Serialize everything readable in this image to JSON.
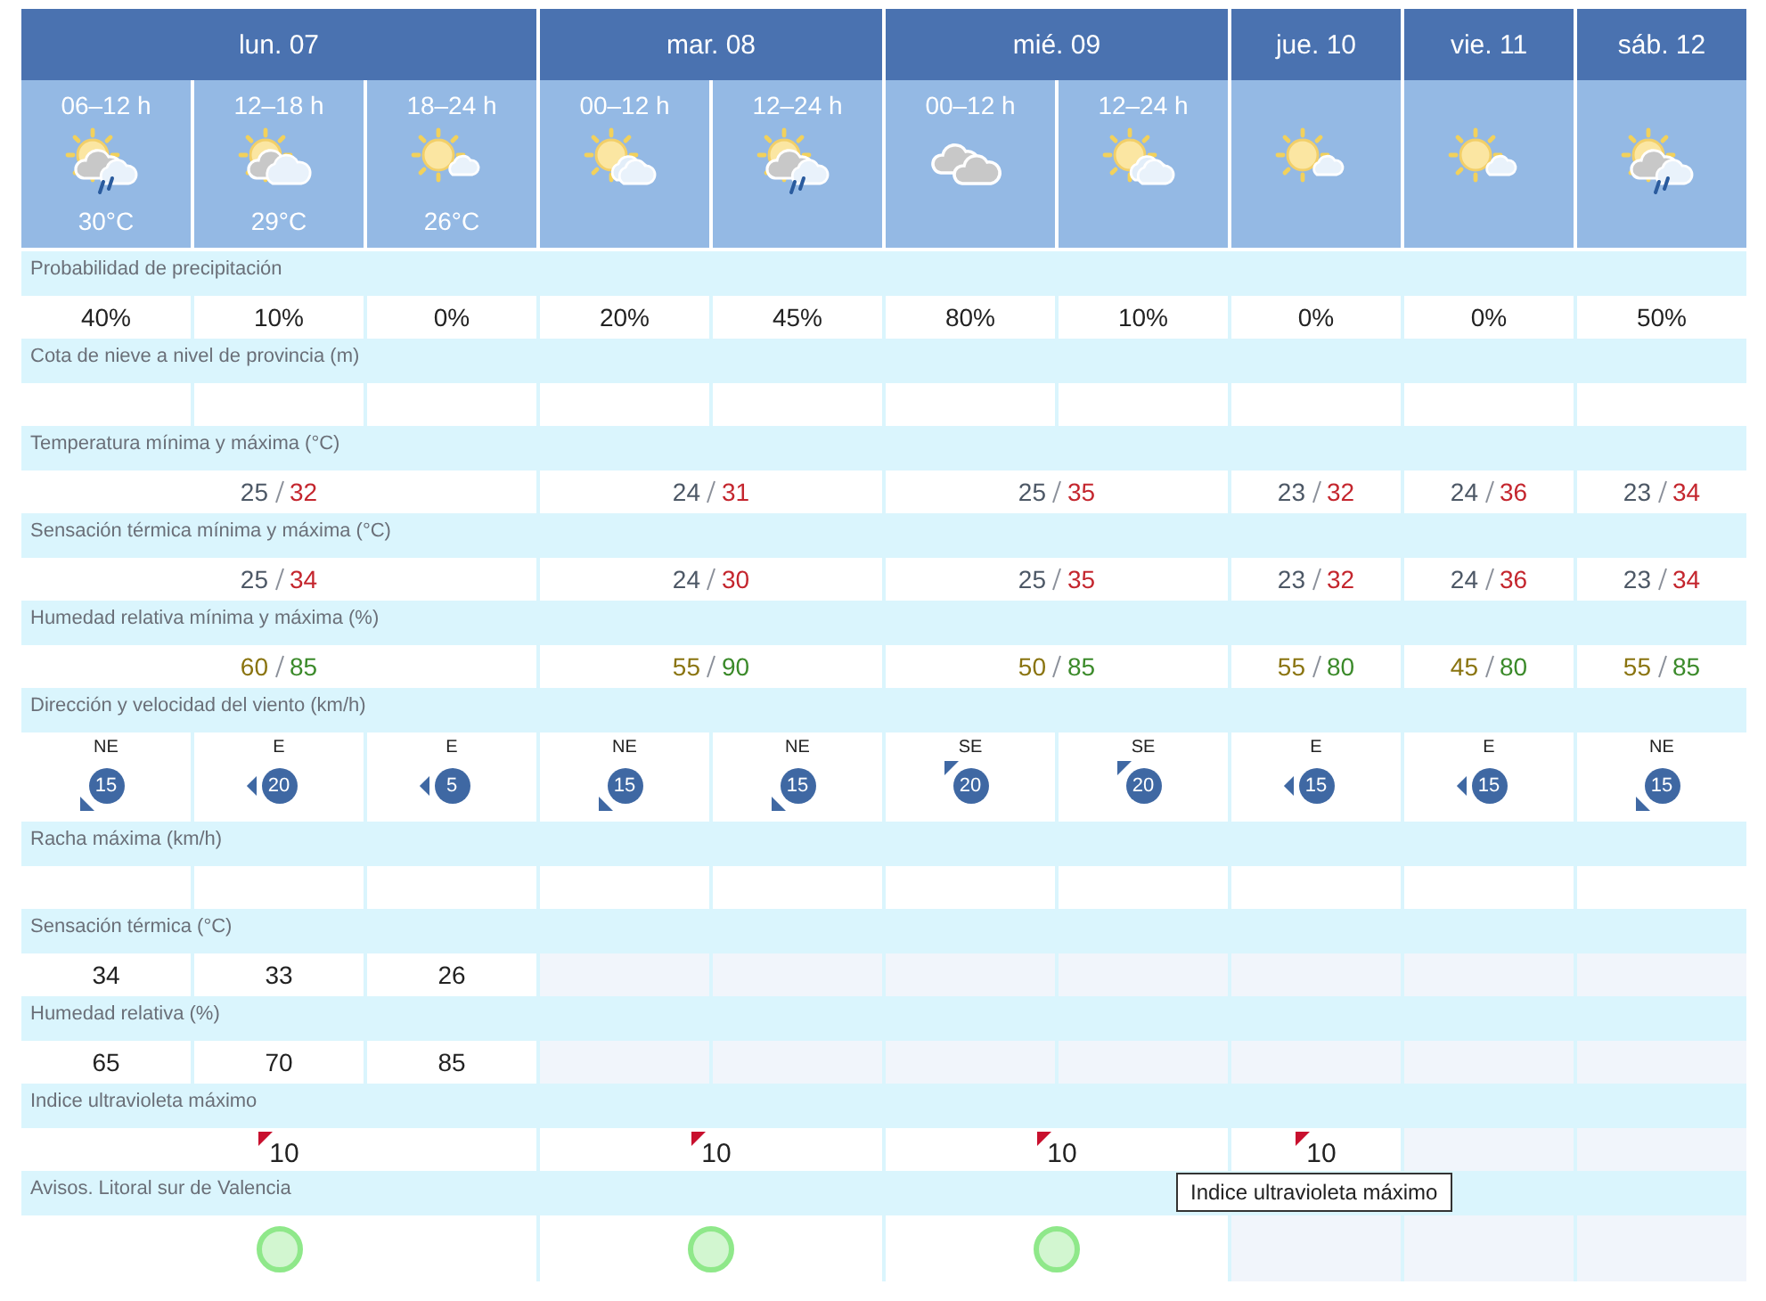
{
  "days": [
    {
      "label": "lun. 07",
      "periods": [
        {
          "label": "06–12 h",
          "kind": "sun-grey-cloud-rain",
          "temp": "30°C"
        },
        {
          "label": "12–18 h",
          "kind": "sun-grey-cloud",
          "temp": "29°C"
        },
        {
          "label": "18–24 h",
          "kind": "sun-small-cloud",
          "temp": "26°C"
        }
      ]
    },
    {
      "label": "mar. 08",
      "periods": [
        {
          "label": "00–12 h",
          "kind": "sun-clouds"
        },
        {
          "label": "12–24 h",
          "kind": "sun-grey-cloud-rain"
        }
      ]
    },
    {
      "label": "mié. 09",
      "periods": [
        {
          "label": "00–12 h",
          "kind": "grey-clouds"
        },
        {
          "label": "12–24 h",
          "kind": "sun-clouds"
        }
      ]
    },
    {
      "label": "jue. 10",
      "periods": [
        {
          "kind": "sun-small-cloud"
        }
      ]
    },
    {
      "label": "vie. 11",
      "periods": [
        {
          "kind": "sun-small-cloud"
        }
      ]
    },
    {
      "label": "sáb. 12",
      "periods": [
        {
          "kind": "sun-grey-cloud-rain"
        }
      ]
    }
  ],
  "rows": [
    {
      "title": "Probabilidad de precipitación",
      "kind": "period",
      "values": [
        {
          "kind": "value",
          "text": "40%"
        },
        {
          "kind": "value",
          "text": "10%"
        },
        {
          "kind": "value",
          "text": "0%"
        },
        {
          "kind": "value",
          "text": "20%"
        },
        {
          "kind": "value",
          "text": "45%"
        },
        {
          "kind": "value",
          "text": "80%"
        },
        {
          "kind": "value",
          "text": "10%"
        },
        {
          "kind": "value",
          "text": "0%"
        },
        {
          "kind": "value",
          "text": "0%"
        },
        {
          "kind": "value",
          "text": "50%"
        }
      ]
    },
    {
      "title": "Cota de nieve a nivel de provincia (m)",
      "kind": "blank"
    },
    {
      "title": "Temperatura mínima y máxima (°C)",
      "kind": "minmax-temperature",
      "values": [
        {
          "min": "25",
          "max": "32"
        },
        {
          "min": "24",
          "max": "31"
        },
        {
          "min": "25",
          "max": "35"
        },
        {
          "min": "23",
          "max": "32"
        },
        {
          "min": "24",
          "max": "36"
        },
        {
          "min": "23",
          "max": "34"
        }
      ]
    },
    {
      "title": "Sensación térmica mínima y máxima (°C)",
      "kind": "minmax-temperature",
      "values": [
        {
          "min": "25",
          "max": "34"
        },
        {
          "min": "24",
          "max": "30"
        },
        {
          "min": "25",
          "max": "35"
        },
        {
          "min": "23",
          "max": "32"
        },
        {
          "min": "24",
          "max": "36"
        },
        {
          "min": "23",
          "max": "34"
        }
      ]
    },
    {
      "title": "Humedad relativa mínima y máxima (%)",
      "kind": "minmax-humidity",
      "values": [
        {
          "min": "60",
          "max": "85"
        },
        {
          "min": "55",
          "max": "90"
        },
        {
          "min": "50",
          "max": "85"
        },
        {
          "min": "55",
          "max": "80"
        },
        {
          "min": "45",
          "max": "80"
        },
        {
          "min": "55",
          "max": "85"
        }
      ]
    },
    {
      "title": "Dirección y velocidad del viento (km/h)",
      "kind": "wind",
      "values": [
        {
          "dir": "NE",
          "speed": "15"
        },
        {
          "dir": "E",
          "speed": "20"
        },
        {
          "dir": "E",
          "speed": "5"
        },
        {
          "dir": "NE",
          "speed": "15"
        },
        {
          "dir": "NE",
          "speed": "15"
        },
        {
          "dir": "SE",
          "speed": "20"
        },
        {
          "dir": "SE",
          "speed": "20"
        },
        {
          "dir": "E",
          "speed": "15"
        },
        {
          "dir": "E",
          "speed": "15"
        },
        {
          "dir": "NE",
          "speed": "15"
        }
      ]
    },
    {
      "title": "Racha máxima (km/h)",
      "kind": "blank"
    },
    {
      "title": "Sensación térmica (°C)",
      "kind": "period",
      "values": [
        {
          "kind": "value",
          "text": "34"
        },
        {
          "kind": "value",
          "text": "33"
        },
        {
          "kind": "value",
          "text": "26"
        },
        {
          "kind": "no-data"
        },
        {
          "kind": "no-data"
        },
        {
          "kind": "no-data"
        },
        {
          "kind": "no-data"
        },
        {
          "kind": "no-data"
        },
        {
          "kind": "no-data"
        },
        {
          "kind": "no-data"
        }
      ]
    },
    {
      "title": "Humedad relativa (%)",
      "kind": "period",
      "values": [
        {
          "kind": "value",
          "text": "65"
        },
        {
          "kind": "value",
          "text": "70"
        },
        {
          "kind": "value",
          "text": "85"
        },
        {
          "kind": "no-data"
        },
        {
          "kind": "no-data"
        },
        {
          "kind": "no-data"
        },
        {
          "kind": "no-data"
        },
        {
          "kind": "no-data"
        },
        {
          "kind": "no-data"
        },
        {
          "kind": "no-data"
        }
      ]
    },
    {
      "title": "Indice ultravioleta máximo",
      "kind": "uv",
      "values": [
        {
          "kind": "value",
          "text": "10"
        },
        {
          "kind": "value",
          "text": "10"
        },
        {
          "kind": "value",
          "text": "10"
        },
        {
          "kind": "value",
          "text": "10"
        },
        {
          "kind": "no-data"
        },
        {
          "kind": "no-data"
        }
      ]
    },
    {
      "title": "Avisos. Litoral sur de Valencia",
      "kind": "warning",
      "values": [
        {
          "kind": "value",
          "color": "#8fe88a"
        },
        {
          "kind": "value",
          "color": "#8fe88a"
        },
        {
          "kind": "value",
          "color": "#8fe88a"
        },
        {
          "kind": "no-data"
        },
        {
          "kind": "no-data"
        },
        {
          "kind": "no-data"
        }
      ]
    }
  ],
  "tooltip": {
    "text": "Indice ultravioleta máximo"
  }
}
